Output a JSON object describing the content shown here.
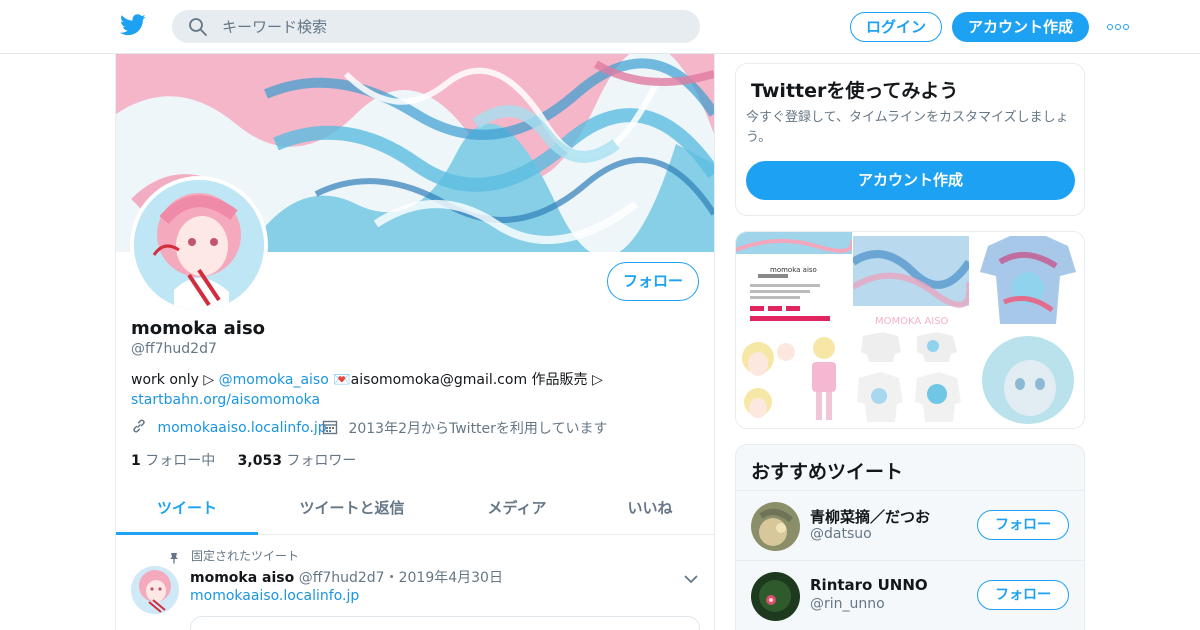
{
  "header": {
    "logo": "twitter-bird-icon",
    "search_placeholder": "キーワード検索",
    "login_label": "ログイン",
    "signup_label": "アカウント作成",
    "more_icon": "more-dots-icon",
    "brand_color": "#1da1f2"
  },
  "profile": {
    "follow_label": "フォロー",
    "name": "momoka aiso",
    "handle": "@ff7hud2d7",
    "bio_prefix": "work only ▷ ",
    "bio_mention": "@momoka_aiso",
    "bio_mid": " 💌aisomomoka@gmail.com 作品販売 ▷",
    "bio_link": "startbahn.org/aisomomoka",
    "website": "momokaaiso.localinfo.jp",
    "joined": "2013年2月からTwitterを利用しています",
    "following_count": "1",
    "following_label": "フォロー中",
    "followers_count": "3,053",
    "followers_label": "フォロワー"
  },
  "tabs": [
    {
      "label": "ツイート",
      "active": true
    },
    {
      "label": "ツイートと返信",
      "active": false
    },
    {
      "label": "メディア",
      "active": false
    },
    {
      "label": "いいね",
      "active": false
    }
  ],
  "pinned_tweet": {
    "pinned_label": "固定されたツイート",
    "name": "momoka aiso",
    "handle": "@ff7hud2d7",
    "separator": "・",
    "date": "2019年4月30日",
    "link": "momokaaiso.localinfo.jp"
  },
  "signup_card": {
    "title": "Twitterを使ってみよう",
    "description": "今すぐ登録して、タイムラインをカスタマイズしましょう。",
    "button_label": "アカウント作成"
  },
  "recommended": {
    "title": "おすすめツイート",
    "items": [
      {
        "name": "青柳菜摘／だつお",
        "handle": "@datsuo",
        "follow_label": "フォロー"
      },
      {
        "name": "Rintaro UNNO",
        "handle": "@rin_unno",
        "follow_label": "フォロー"
      }
    ]
  },
  "media_grid": {
    "thumb_text": "momoka aiso",
    "thumb_text_2": "MOMOKA AISO"
  }
}
